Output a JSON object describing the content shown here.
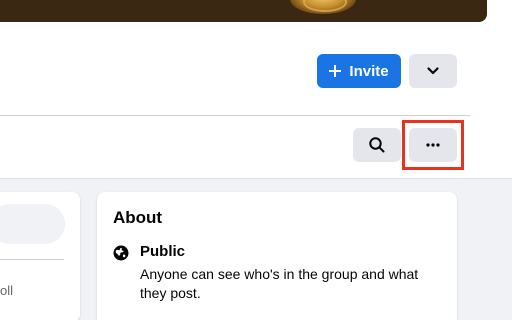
{
  "header": {
    "invite_label": "Invite"
  },
  "about": {
    "title": "About",
    "privacy_title": "Public",
    "privacy_description": "Anyone can see who's in the group and what they post."
  },
  "left_panel": {
    "partial_label": "oll"
  },
  "icons": {
    "invite": "plus-icon",
    "dropdown": "chevron-down-icon",
    "search": "search-icon",
    "more": "more-horizontal-icon",
    "privacy": "globe-icon"
  },
  "colors": {
    "primary_button": "#1b74e4",
    "secondary_button": "#e4e6eb",
    "highlight": "#e8321f",
    "feed_background": "#f0f2f5"
  }
}
